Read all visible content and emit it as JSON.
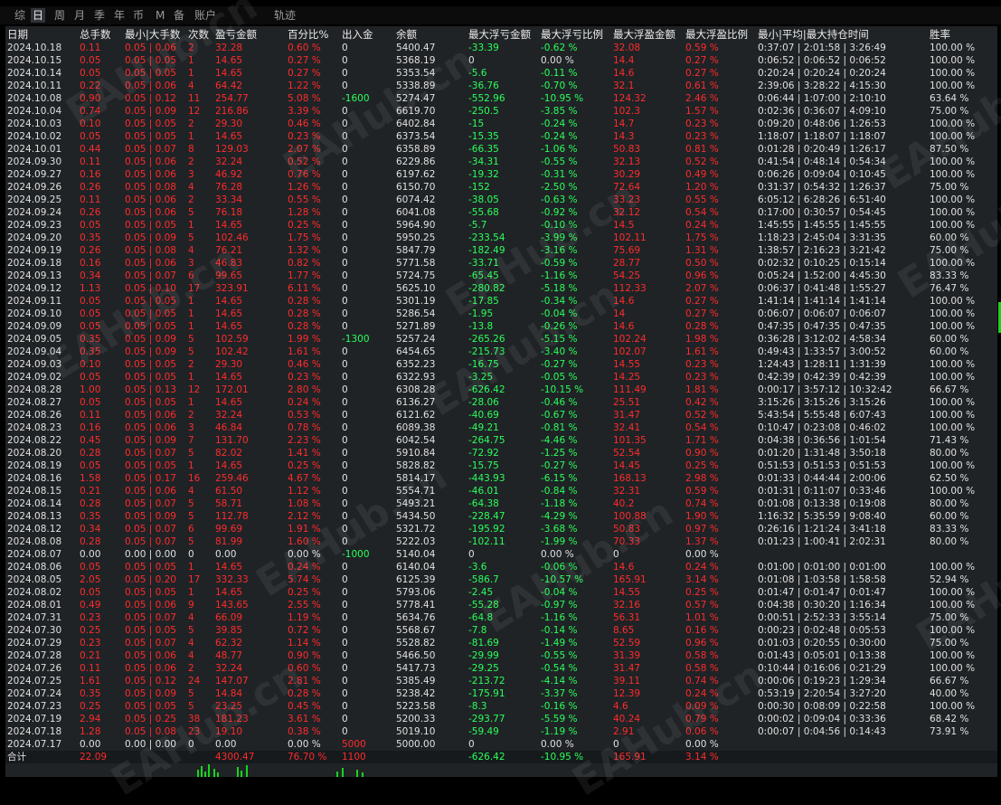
{
  "toolbar": {
    "tabs": [
      "综",
      "日",
      "周",
      "月",
      "季",
      "年",
      "币",
      "M",
      "备",
      "账户",
      "轨迹"
    ],
    "active": 1
  },
  "columns": [
    "日期",
    "总手数",
    "最小|大手数",
    "次数",
    "盈亏金额",
    "百分比%",
    "出入金",
    "余额",
    "最大浮亏金额",
    "最大浮亏比例",
    "最大浮盈金额",
    "最大浮盈比例",
    "最小|平均|最大持仓时间",
    "胜率"
  ],
  "rows": [
    [
      "2024.10.18",
      "0.11",
      "0.05 | 0.06",
      "2",
      "32.28",
      "0.60 %",
      "0",
      "5400.47",
      "-33.39",
      "-0.62 %",
      "32.08",
      "0.59 %",
      "0:37:07 | 2:01:58 | 3:26:49",
      "100.00 %"
    ],
    [
      "2024.10.15",
      "0.05",
      "0.05 | 0.05",
      "1",
      "14.65",
      "0.27 %",
      "0",
      "5368.19",
      "0",
      "0.00 %",
      "14.4",
      "0.27 %",
      "0:06:52 | 0:06:52 | 0:06:52",
      "100.00 %"
    ],
    [
      "2024.10.14",
      "0.05",
      "0.05 | 0.05",
      "1",
      "14.65",
      "0.27 %",
      "0",
      "5353.54",
      "-5.6",
      "-0.11 %",
      "14.6",
      "0.27 %",
      "0:20:24 | 0:20:24 | 0:20:24",
      "100.00 %"
    ],
    [
      "2024.10.11",
      "0.22",
      "0.05 | 0.06",
      "4",
      "64.42",
      "1.22 %",
      "0",
      "5338.89",
      "-36.76",
      "-0.70 %",
      "32.1",
      "0.61 %",
      "2:39:06 | 3:28:22 | 4:15:30",
      "100.00 %"
    ],
    [
      "2024.10.08",
      "0.90",
      "0.05 | 0.12",
      "11",
      "254.77",
      "5.08 %",
      "-1600",
      "5274.47",
      "-552.96",
      "-10.95 %",
      "124.32",
      "2.46 %",
      "0:06:44 | 1:07:00 | 2:10:10",
      "63.64 %"
    ],
    [
      "2024.10.04",
      "0.74",
      "0.05 | 0.09",
      "12",
      "216.86",
      "3.39 %",
      "0",
      "6619.70",
      "-250.5",
      "-3.85 %",
      "102.3",
      "1.57 %",
      "0:02:36 | 0:36:07 | 4:09:10",
      "75.00 %"
    ],
    [
      "2024.10.03",
      "0.10",
      "0.05 | 0.05",
      "2",
      "29.30",
      "0.46 %",
      "0",
      "6402.84",
      "-15",
      "-0.24 %",
      "14.7",
      "0.23 %",
      "0:09:20 | 0:48:06 | 1:26:53",
      "100.00 %"
    ],
    [
      "2024.10.02",
      "0.05",
      "0.05 | 0.05",
      "1",
      "14.65",
      "0.23 %",
      "0",
      "6373.54",
      "-15.35",
      "-0.24 %",
      "14.3",
      "0.23 %",
      "1:18:07 | 1:18:07 | 1:18:07",
      "100.00 %"
    ],
    [
      "2024.10.01",
      "0.44",
      "0.05 | 0.07",
      "8",
      "129.03",
      "2.07 %",
      "0",
      "6358.89",
      "-66.35",
      "-1.06 %",
      "50.83",
      "0.81 %",
      "0:01:28 | 0:20:49 | 1:26:17",
      "87.50 %"
    ],
    [
      "2024.09.30",
      "0.11",
      "0.05 | 0.06",
      "2",
      "32.24",
      "0.52 %",
      "0",
      "6229.86",
      "-34.31",
      "-0.55 %",
      "32.13",
      "0.52 %",
      "0:41:54 | 0:48:14 | 0:54:34",
      "100.00 %"
    ],
    [
      "2024.09.27",
      "0.16",
      "0.05 | 0.06",
      "3",
      "46.92",
      "0.76 %",
      "0",
      "6197.62",
      "-19.32",
      "-0.31 %",
      "30.29",
      "0.49 %",
      "0:06:26 | 0:09:04 | 0:10:45",
      "100.00 %"
    ],
    [
      "2024.09.26",
      "0.26",
      "0.05 | 0.08",
      "4",
      "76.28",
      "1.26 %",
      "0",
      "6150.70",
      "-152",
      "-2.50 %",
      "72.64",
      "1.20 %",
      "0:31:37 | 0:54:32 | 1:26:37",
      "75.00 %"
    ],
    [
      "2024.09.25",
      "0.11",
      "0.05 | 0.06",
      "2",
      "33.34",
      "0.55 %",
      "0",
      "6074.42",
      "-38.05",
      "-0.63 %",
      "33.23",
      "0.55 %",
      "6:05:12 | 6:28:26 | 6:51:40",
      "100.00 %"
    ],
    [
      "2024.09.24",
      "0.26",
      "0.05 | 0.06",
      "5",
      "76.18",
      "1.28 %",
      "0",
      "6041.08",
      "-55.68",
      "-0.92 %",
      "32.12",
      "0.54 %",
      "0:17:00 | 0:30:57 | 0:54:45",
      "100.00 %"
    ],
    [
      "2024.09.23",
      "0.05",
      "0.05 | 0.05",
      "1",
      "14.65",
      "0.25 %",
      "0",
      "5964.90",
      "-5.7",
      "-0.10 %",
      "14.5",
      "0.24 %",
      "1:45:55 | 1:45:55 | 1:45:55",
      "100.00 %"
    ],
    [
      "2024.09.20",
      "0.35",
      "0.05 | 0.09",
      "5",
      "102.46",
      "1.75 %",
      "0",
      "5950.25",
      "-233.54",
      "-3.99 %",
      "102.11",
      "1.75 %",
      "1:18:23 | 2:45:04 | 3:31:35",
      "60.00 %"
    ],
    [
      "2024.09.19",
      "0.26",
      "0.05 | 0.08",
      "4",
      "76.21",
      "1.32 %",
      "0",
      "5847.79",
      "-182.49",
      "-3.16 %",
      "75.69",
      "1.31 %",
      "1:38:57 | 2:16:23 | 3:21:42",
      "75.00 %"
    ],
    [
      "2024.09.18",
      "0.16",
      "0.05 | 0.06",
      "3",
      "46.83",
      "0.82 %",
      "0",
      "5771.58",
      "-33.71",
      "-0.59 %",
      "28.77",
      "0.50 %",
      "0:02:32 | 0:10:25 | 0:15:14",
      "100.00 %"
    ],
    [
      "2024.09.13",
      "0.34",
      "0.05 | 0.07",
      "6",
      "99.65",
      "1.77 %",
      "0",
      "5724.75",
      "-65.45",
      "-1.16 %",
      "54.25",
      "0.96 %",
      "0:05:24 | 1:52:00 | 4:45:30",
      "83.33 %"
    ],
    [
      "2024.09.12",
      "1.13",
      "0.05 | 0.10",
      "17",
      "323.91",
      "6.11 %",
      "0",
      "5625.10",
      "-280.82",
      "-5.18 %",
      "112.33",
      "2.07 %",
      "0:06:37 | 0:41:48 | 1:55:27",
      "76.47 %"
    ],
    [
      "2024.09.11",
      "0.05",
      "0.05 | 0.05",
      "1",
      "14.65",
      "0.28 %",
      "0",
      "5301.19",
      "-17.85",
      "-0.34 %",
      "14.6",
      "0.27 %",
      "1:41:14 | 1:41:14 | 1:41:14",
      "100.00 %"
    ],
    [
      "2024.09.10",
      "0.05",
      "0.05 | 0.05",
      "1",
      "14.65",
      "0.28 %",
      "0",
      "5286.54",
      "-1.95",
      "-0.04 %",
      "14",
      "0.27 %",
      "0:06:07 | 0:06:07 | 0:06:07",
      "100.00 %"
    ],
    [
      "2024.09.09",
      "0.05",
      "0.05 | 0.05",
      "1",
      "14.65",
      "0.28 %",
      "0",
      "5271.89",
      "-13.8",
      "-0.26 %",
      "14.6",
      "0.28 %",
      "0:47:35 | 0:47:35 | 0:47:35",
      "100.00 %"
    ],
    [
      "2024.09.05",
      "0.35",
      "0.05 | 0.09",
      "5",
      "102.59",
      "1.99 %",
      "-1300",
      "5257.24",
      "-265.26",
      "-5.15 %",
      "102.24",
      "1.98 %",
      "0:36:28 | 3:12:02 | 4:58:34",
      "60.00 %"
    ],
    [
      "2024.09.04",
      "0.35",
      "0.05 | 0.09",
      "5",
      "102.42",
      "1.61 %",
      "0",
      "6454.65",
      "-215.73",
      "-3.40 %",
      "102.07",
      "1.61 %",
      "0:49:43 | 1:33:57 | 3:00:52",
      "60.00 %"
    ],
    [
      "2024.09.03",
      "0.10",
      "0.05 | 0.05",
      "2",
      "29.30",
      "0.46 %",
      "0",
      "6352.23",
      "-16.75",
      "-0.27 %",
      "14.55",
      "0.23 %",
      "1:24:43 | 1:28:11 | 1:31:39",
      "100.00 %"
    ],
    [
      "2024.09.02",
      "0.05",
      "0.05 | 0.05",
      "1",
      "14.65",
      "0.23 %",
      "0",
      "6322.93",
      "-3.25",
      "-0.05 %",
      "14.25",
      "0.23 %",
      "0:42:39 | 0:42:39 | 0:42:39",
      "100.00 %"
    ],
    [
      "2024.08.28",
      "1.00",
      "0.05 | 0.13",
      "12",
      "172.01",
      "2.80 %",
      "0",
      "6308.28",
      "-626.42",
      "-10.15 %",
      "111.49",
      "1.81 %",
      "0:00:17 | 3:57:12 | 10:32:42",
      "66.67 %"
    ],
    [
      "2024.08.27",
      "0.05",
      "0.05 | 0.05",
      "1",
      "14.65",
      "0.24 %",
      "0",
      "6136.27",
      "-28.06",
      "-0.46 %",
      "25.51",
      "0.42 %",
      "3:15:26 | 3:15:26 | 3:15:26",
      "100.00 %"
    ],
    [
      "2024.08.26",
      "0.11",
      "0.05 | 0.06",
      "2",
      "32.24",
      "0.53 %",
      "0",
      "6121.62",
      "-40.69",
      "-0.67 %",
      "31.47",
      "0.52 %",
      "5:43:54 | 5:55:48 | 6:07:43",
      "100.00 %"
    ],
    [
      "2024.08.23",
      "0.16",
      "0.05 | 0.06",
      "3",
      "46.84",
      "0.78 %",
      "0",
      "6089.38",
      "-49.21",
      "-0.81 %",
      "32.41",
      "0.54 %",
      "0:10:47 | 0:23:08 | 0:46:02",
      "100.00 %"
    ],
    [
      "2024.08.22",
      "0.45",
      "0.05 | 0.09",
      "7",
      "131.70",
      "2.23 %",
      "0",
      "6042.54",
      "-264.75",
      "-4.46 %",
      "101.35",
      "1.71 %",
      "0:04:38 | 0:36:56 | 1:01:54",
      "71.43 %"
    ],
    [
      "2024.08.20",
      "0.28",
      "0.05 | 0.07",
      "5",
      "82.02",
      "1.41 %",
      "0",
      "5910.84",
      "-72.92",
      "-1.25 %",
      "52.54",
      "0.90 %",
      "0:01:20 | 1:31:48 | 3:50:18",
      "80.00 %"
    ],
    [
      "2024.08.19",
      "0.05",
      "0.05 | 0.05",
      "1",
      "14.65",
      "0.25 %",
      "0",
      "5828.82",
      "-15.75",
      "-0.27 %",
      "14.45",
      "0.25 %",
      "0:51:53 | 0:51:53 | 0:51:53",
      "100.00 %"
    ],
    [
      "2024.08.16",
      "1.58",
      "0.05 | 0.17",
      "16",
      "259.46",
      "4.67 %",
      "0",
      "5814.17",
      "-443.93",
      "-6.15 %",
      "168.13",
      "2.98 %",
      "0:01:33 | 0:44:44 | 2:00:06",
      "62.50 %"
    ],
    [
      "2024.08.15",
      "0.21",
      "0.05 | 0.06",
      "4",
      "61.50",
      "1.12 %",
      "0",
      "5554.71",
      "-46.01",
      "-0.84 %",
      "32.31",
      "0.59 %",
      "0:01:31 | 0:11:07 | 0:33:46",
      "100.00 %"
    ],
    [
      "2024.08.14",
      "0.28",
      "0.05 | 0.07",
      "5",
      "58.71",
      "1.08 %",
      "0",
      "5493.21",
      "-64.38",
      "-1.18 %",
      "40.2",
      "0.74 %",
      "0:01:08 | 0:13:38 | 0:19:08",
      "80.00 %"
    ],
    [
      "2024.08.13",
      "0.35",
      "0.05 | 0.09",
      "5",
      "112.78",
      "2.12 %",
      "0",
      "5434.50",
      "-228.47",
      "-4.29 %",
      "100.88",
      "1.90 %",
      "1:16:32 | 5:35:59 | 9:08:40",
      "60.00 %"
    ],
    [
      "2024.08.12",
      "0.34",
      "0.05 | 0.07",
      "6",
      "99.69",
      "1.91 %",
      "0",
      "5321.72",
      "-195.92",
      "-3.68 %",
      "50.83",
      "0.97 %",
      "0:26:16 | 1:21:24 | 3:41:18",
      "83.33 %"
    ],
    [
      "2024.08.08",
      "0.28",
      "0.05 | 0.07",
      "5",
      "81.99",
      "1.60 %",
      "0",
      "5222.03",
      "-102.11",
      "-1.99 %",
      "70.33",
      "1.37 %",
      "0:01:23 | 1:00:41 | 2:02:31",
      "80.00 %"
    ],
    [
      "2024.08.07",
      "0.00",
      "0.00 | 0.00",
      "0",
      "0.00",
      "0.00 %",
      "-1000",
      "5140.04",
      "0",
      "0.00 %",
      "0",
      "0.00 %",
      "",
      ""
    ],
    [
      "2024.08.06",
      "0.05",
      "0.05 | 0.05",
      "1",
      "14.65",
      "0.24 %",
      "0",
      "6140.04",
      "-3.6",
      "-0.06 %",
      "14.6",
      "0.24 %",
      "0:01:00 | 0:01:00 | 0:01:00",
      "100.00 %"
    ],
    [
      "2024.08.05",
      "2.05",
      "0.05 | 0.20",
      "17",
      "332.33",
      "5.74 %",
      "0",
      "6125.39",
      "-586.7",
      "-10.57 %",
      "165.91",
      "3.14 %",
      "0:01:08 | 1:03:58 | 1:58:58",
      "52.94 %"
    ],
    [
      "2024.08.02",
      "0.05",
      "0.05 | 0.05",
      "1",
      "14.65",
      "0.25 %",
      "0",
      "5793.06",
      "-2.45",
      "-0.04 %",
      "14.55",
      "0.25 %",
      "0:01:47 | 0:01:47 | 0:01:47",
      "100.00 %"
    ],
    [
      "2024.08.01",
      "0.49",
      "0.05 | 0.06",
      "9",
      "143.65",
      "2.55 %",
      "0",
      "5778.41",
      "-55.28",
      "-0.97 %",
      "32.16",
      "0.57 %",
      "0:04:38 | 0:30:20 | 1:16:34",
      "100.00 %"
    ],
    [
      "2024.07.31",
      "0.23",
      "0.05 | 0.07",
      "4",
      "66.09",
      "1.19 %",
      "0",
      "5634.76",
      "-64.8",
      "-1.16 %",
      "56.31",
      "1.01 %",
      "0:00:51 | 2:52:33 | 3:55:14",
      "75.00 %"
    ],
    [
      "2024.07.30",
      "0.25",
      "0.05 | 0.05",
      "5",
      "39.85",
      "0.72 %",
      "0",
      "5568.67",
      "-7.8",
      "-0.14 %",
      "8.65",
      "0.16 %",
      "0:00:23 | 0:02:48 | 0:05:53",
      "100.00 %"
    ],
    [
      "2024.07.29",
      "0.23",
      "0.05 | 0.07",
      "4",
      "62.32",
      "1.14 %",
      "0",
      "5528.82",
      "-81.69",
      "-1.49 %",
      "52.59",
      "0.96 %",
      "0:01:03 | 0:20:55 | 0:30:00",
      "75.00 %"
    ],
    [
      "2024.07.28",
      "0.21",
      "0.05 | 0.06",
      "4",
      "48.77",
      "0.90 %",
      "0",
      "5466.50",
      "-29.99",
      "-0.55 %",
      "31.39",
      "0.58 %",
      "0:01:43 | 0:05:01 | 0:13:38",
      "100.00 %"
    ],
    [
      "2024.07.26",
      "0.11",
      "0.05 | 0.06",
      "2",
      "32.24",
      "0.60 %",
      "0",
      "5417.73",
      "-29.25",
      "-0.54 %",
      "31.47",
      "0.58 %",
      "0:10:44 | 0:16:06 | 0:21:29",
      "100.00 %"
    ],
    [
      "2024.07.25",
      "1.61",
      "0.05 | 0.12",
      "24",
      "147.07",
      "2.81 %",
      "0",
      "5385.49",
      "-213.72",
      "-4.14 %",
      "39.11",
      "0.74 %",
      "0:00:06 | 0:19:23 | 1:29:34",
      "66.67 %"
    ],
    [
      "2024.07.24",
      "0.35",
      "0.05 | 0.09",
      "5",
      "14.84",
      "0.28 %",
      "0",
      "5238.42",
      "-175.91",
      "-3.37 %",
      "12.39",
      "0.24 %",
      "0:53:19 | 2:20:54 | 3:27:20",
      "40.00 %"
    ],
    [
      "2024.07.23",
      "0.25",
      "0.05 | 0.05",
      "5",
      "23.25",
      "0.45 %",
      "0",
      "5223.58",
      "-8.3",
      "-0.16 %",
      "4.6",
      "0.09 %",
      "0:00:30 | 0:08:09 | 0:22:58",
      "100.00 %"
    ],
    [
      "2024.07.19",
      "2.94",
      "0.05 | 0.25",
      "38",
      "181.23",
      "3.61 %",
      "0",
      "5200.33",
      "-293.77",
      "-5.59 %",
      "40.24",
      "0.79 %",
      "0:00:02 | 0:09:04 | 0:33:36",
      "68.42 %"
    ],
    [
      "2024.07.18",
      "1.28",
      "0.05 | 0.08",
      "23",
      "19.10",
      "0.38 %",
      "0",
      "5019.10",
      "-59.49",
      "-1.19 %",
      "2.91",
      "0.06 %",
      "0:00:07 | 0:04:56 | 0:14:43",
      "73.91 %"
    ],
    [
      "2024.07.17",
      "0.00",
      "0.00 | 0.00",
      "0",
      "0.00",
      "0.00 %",
      "5000",
      "5000.00",
      "0",
      "0.00 %",
      "0",
      "0.00 %",
      "",
      ""
    ]
  ],
  "total": [
    "合计",
    "22.09",
    "",
    "",
    "4300.47",
    "76.70 %",
    "1100",
    "",
    "-626.42",
    "-10.95 %",
    "165.91",
    "3.14 %",
    "",
    ""
  ],
  "watermark": "EAHub.cn",
  "colors": {
    "positive": "#ff2b2b",
    "negative": "#2bff5a",
    "panel": "#1f2326",
    "background": "#000000"
  }
}
